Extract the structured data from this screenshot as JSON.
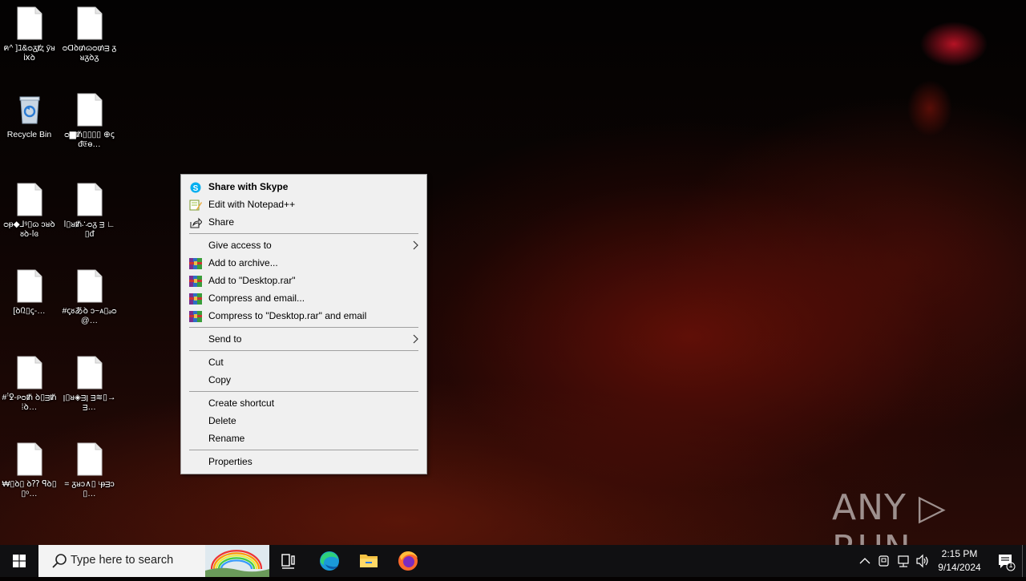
{
  "desktop": {
    "icons": [
      {
        "label": "ฅ^ ]ﾕ&ᴑᵹⱦⱬ ȳᴚ ⅸꝺ",
        "type": "file",
        "selected": false
      },
      {
        "label": "ᴑⱭꝺ₥ɷᴑ₥ᴟ ᵹᴚᵹꝺᵹ",
        "type": "file",
        "selected": false
      },
      {
        "label": "Recycle Bin",
        "type": "recycle-bin",
        "selected": false
      },
      {
        "label": "ᴑ▆ᵺ▯▯▯▯ ⊕ꞔᵭ𝔈ɵ…",
        "type": "file",
        "selected": false
      },
      {
        "label": "ᴑᵽ◆⅃ꝰ▯ɷ ɔᴚꝺᴕꝺ-ⅼɞ",
        "type": "file",
        "selected": false
      },
      {
        "label": "ⅼ▯ᴚᵺ∴ᴑᵹ ᴟ ∟▯ᵭ",
        "type": "file",
        "selected": false
      },
      {
        "label": "[ꝺ᠒▯ꞔ-…",
        "type": "file",
        "selected": false
      },
      {
        "label": "#ꞔᴕあꝺ ᴐ~ᴀ▯ₔᴑ@…",
        "type": "file",
        "selected": false
      },
      {
        "label": "#ꜝꝿ-ᴩᴑᵺ ꝺ▯ᴟᵺ⁞ꝺ…",
        "type": "file",
        "selected": false
      },
      {
        "label": "ꞁ▯ᴚ◈ᴟꞁ ᴟ≋▯→ᴟ…",
        "type": "file",
        "selected": false
      },
      {
        "label": "₩▯ꝺ▯ ꝺ⁇ ꟼꝺ▯▯ᵒ…",
        "type": "file",
        "selected": false
      },
      {
        "label": "= ᵹᴚᴐ∧▯ ᶫᵽᴟᴐ▯…",
        "type": "file",
        "selected": false
      }
    ]
  },
  "context_menu": {
    "items": [
      {
        "kind": "item",
        "label": "Share with Skype",
        "icon": "skype-icon",
        "bold": true
      },
      {
        "kind": "item",
        "label": "Edit with Notepad++",
        "icon": "notepadpp-icon"
      },
      {
        "kind": "item",
        "label": "Share",
        "icon": "share-icon"
      },
      {
        "kind": "sep"
      },
      {
        "kind": "item",
        "label": "Give access to",
        "submenu": true
      },
      {
        "kind": "item",
        "label": "Add to archive...",
        "icon": "winrar-icon"
      },
      {
        "kind": "item",
        "label": "Add to \"Desktop.rar\"",
        "icon": "winrar-icon"
      },
      {
        "kind": "item",
        "label": "Compress and email...",
        "icon": "winrar-icon"
      },
      {
        "kind": "item",
        "label": "Compress to \"Desktop.rar\" and email",
        "icon": "winrar-icon"
      },
      {
        "kind": "sep"
      },
      {
        "kind": "item",
        "label": "Send to",
        "submenu": true
      },
      {
        "kind": "sep"
      },
      {
        "kind": "item",
        "label": "Cut"
      },
      {
        "kind": "item",
        "label": "Copy"
      },
      {
        "kind": "sep"
      },
      {
        "kind": "item",
        "label": "Create shortcut"
      },
      {
        "kind": "item",
        "label": "Delete"
      },
      {
        "kind": "item",
        "label": "Rename"
      },
      {
        "kind": "sep"
      },
      {
        "kind": "item",
        "label": "Properties"
      }
    ]
  },
  "taskbar": {
    "search_placeholder": "Type here to search",
    "time": "2:15 PM",
    "date": "9/14/2024",
    "notification_count": "1",
    "pinned": [
      "task-view-icon",
      "edge-icon",
      "file-explorer-icon",
      "firefox-icon"
    ]
  },
  "watermark": {
    "text": "ANY ▷ RUN"
  },
  "colors": {
    "menu_bg": "#f0f0f0",
    "taskbar_bg": "#101012",
    "selection": "#9ab"
  }
}
